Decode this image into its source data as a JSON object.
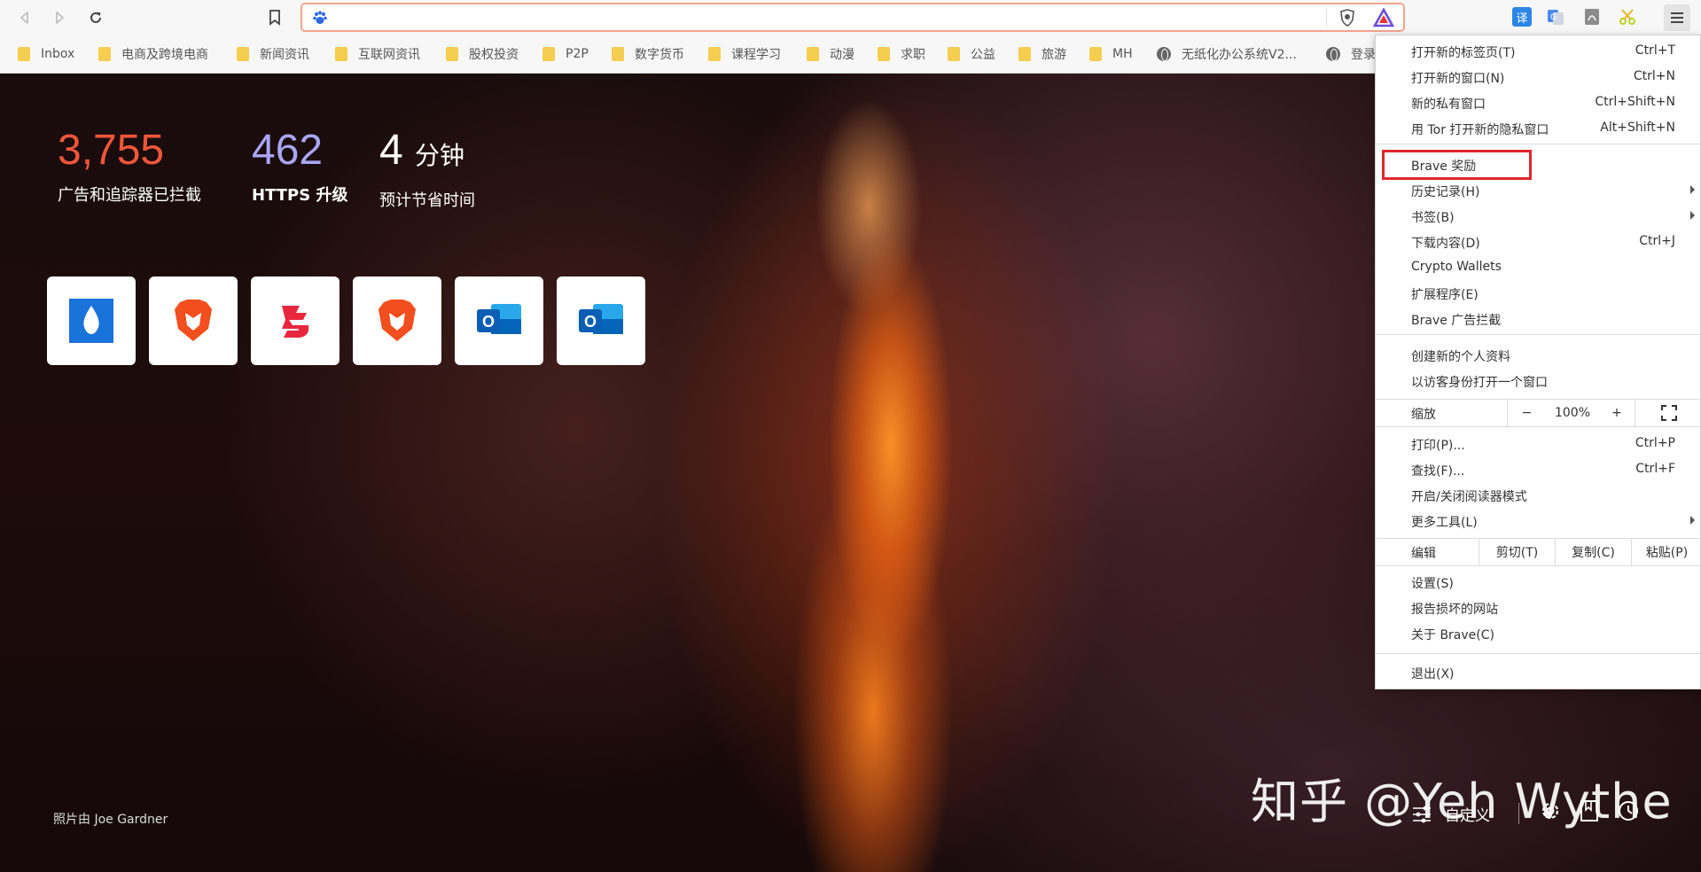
{
  "toolbar": {
    "address_value": "",
    "address_placeholder": ""
  },
  "bookmarks": [
    {
      "label": "Inbox",
      "type": "folder"
    },
    {
      "label": "电商及跨境电商",
      "type": "folder"
    },
    {
      "label": "新闻资讯",
      "type": "folder"
    },
    {
      "label": "互联网资讯",
      "type": "folder"
    },
    {
      "label": "股权投资",
      "type": "folder"
    },
    {
      "label": "P2P",
      "type": "folder"
    },
    {
      "label": "数字货币",
      "type": "folder"
    },
    {
      "label": "课程学习",
      "type": "folder"
    },
    {
      "label": "动漫",
      "type": "folder"
    },
    {
      "label": "求职",
      "type": "folder"
    },
    {
      "label": "公益",
      "type": "folder"
    },
    {
      "label": "旅游",
      "type": "folder"
    },
    {
      "label": "MH",
      "type": "folder"
    },
    {
      "label": "无纸化办公系统V2...",
      "type": "site"
    },
    {
      "label": "登录",
      "type": "site"
    }
  ],
  "stats": {
    "ads_blocked": {
      "value": "3,755",
      "label": "广告和追踪器已拦截",
      "color": "#f0563a"
    },
    "https": {
      "value": "462",
      "label": "HTTPS 升级",
      "color": "#a9a6f5"
    },
    "time_saved": {
      "value": "4",
      "unit": "分钟",
      "label": "预计节省时间",
      "color": "#ffffff"
    }
  },
  "tiles": [
    {
      "icon": "water-drop-icon"
    },
    {
      "icon": "brave-lion-icon"
    },
    {
      "icon": "dragon-logo-icon"
    },
    {
      "icon": "brave-lion-icon"
    },
    {
      "icon": "outlook-icon"
    },
    {
      "icon": "outlook-icon"
    }
  ],
  "credit": "照片由 Joe Gardner",
  "watermark": "知乎 @Yeh Wythe",
  "customize_label": "自定义",
  "menu": {
    "items": [
      {
        "label": "打开新的标签页(T)",
        "shortcut": "Ctrl+T"
      },
      {
        "label": "打开新的窗口(N)",
        "shortcut": "Ctrl+N"
      },
      {
        "label": "新的私有窗口",
        "shortcut": "Ctrl+Shift+N"
      },
      {
        "label": "用 Tor 打开新的隐私窗口",
        "shortcut": "Alt+Shift+N"
      },
      {
        "label": "Brave 奖励",
        "shortcut": ""
      },
      {
        "label": "历史记录(H)",
        "shortcut": ""
      },
      {
        "label": "书签(B)",
        "shortcut": ""
      },
      {
        "label": "下载内容(D)",
        "shortcut": "Ctrl+J"
      },
      {
        "label": "Crypto Wallets",
        "shortcut": ""
      },
      {
        "label": "扩展程序(E)",
        "shortcut": ""
      },
      {
        "label": "Brave 广告拦截",
        "shortcut": ""
      },
      {
        "label": "创建新的个人资料",
        "shortcut": ""
      },
      {
        "label": "以访客身份打开一个窗口",
        "shortcut": ""
      },
      {
        "label": "打印(P)...",
        "shortcut": "Ctrl+P"
      },
      {
        "label": "查找(F)...",
        "shortcut": "Ctrl+F"
      },
      {
        "label": "开启/关闭阅读器模式",
        "shortcut": ""
      },
      {
        "label": "更多工具(L)",
        "shortcut": ""
      },
      {
        "label": "设置(S)",
        "shortcut": ""
      },
      {
        "label": "报告损坏的网站",
        "shortcut": ""
      },
      {
        "label": "关于 Brave(C)",
        "shortcut": ""
      },
      {
        "label": "退出(X)",
        "shortcut": ""
      }
    ],
    "zoom": {
      "label": "缩放",
      "minus": "−",
      "value": "100%",
      "plus": "+"
    },
    "edit": {
      "label": "编辑",
      "cut": "剪切(T)",
      "copy": "复制(C)",
      "paste": "粘贴(P)"
    }
  }
}
